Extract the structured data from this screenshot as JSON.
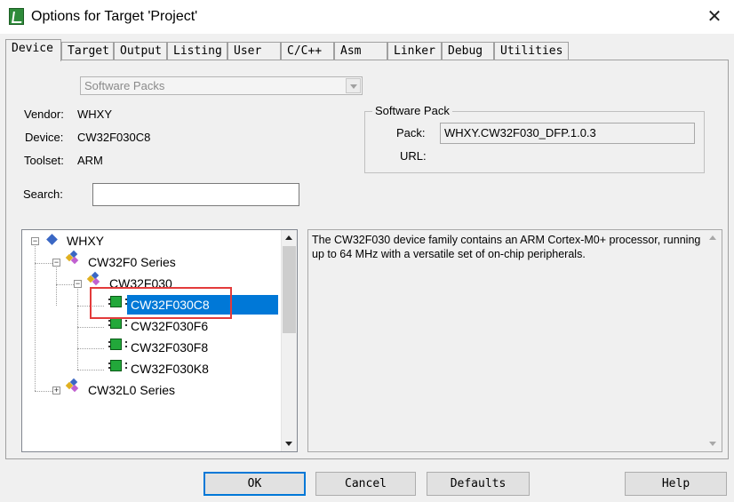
{
  "window": {
    "title": "Options for Target 'Project'",
    "close_glyph": "✕"
  },
  "tabs": [
    {
      "label": "Device",
      "active": true
    },
    {
      "label": "Target"
    },
    {
      "label": "Output"
    },
    {
      "label": "Listing"
    },
    {
      "label": "User"
    },
    {
      "label": "C/C++"
    },
    {
      "label": "Asm"
    },
    {
      "label": "Linker"
    },
    {
      "label": "Debug"
    },
    {
      "label": "Utilities"
    }
  ],
  "device": {
    "database_select": "Software Packs",
    "vendor_label": "Vendor:",
    "vendor_value": "WHXY",
    "device_label": "Device:",
    "device_value": "CW32F030C8",
    "toolset_label": "Toolset:",
    "toolset_value": "ARM",
    "search_label": "Search:",
    "search_value": ""
  },
  "software_pack": {
    "title": "Software Pack",
    "pack_label": "Pack:",
    "pack_value": "WHXY.CW32F030_DFP.1.0.3",
    "url_label": "URL:"
  },
  "tree": {
    "vendor": "WHXY",
    "series": [
      "CW32F0 Series",
      "CW32L0 Series"
    ],
    "subfamily": "CW32F030",
    "devices": [
      "CW32F030C8",
      "CW32F030F6",
      "CW32F030F8",
      "CW32F030K8"
    ],
    "selected": "CW32F030C8"
  },
  "description": "The CW32F030 device family contains an ARM Cortex-M0+ processor, running up to 64 MHz with a versatile set of on-chip peripherals.",
  "buttons": {
    "ok": "OK",
    "cancel": "Cancel",
    "defaults": "Defaults",
    "help": "Help"
  },
  "colors": {
    "selection": "#0078d7",
    "highlight_box": "#e33b3b"
  }
}
